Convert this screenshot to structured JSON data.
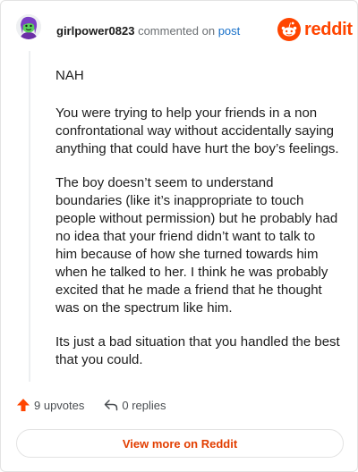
{
  "comment": {
    "author": "girlpower0823",
    "commented_on_text": "commented on",
    "post_link_label": "post",
    "paragraphs": [
      "NAH",
      "You were trying to help your friends in a non confrontational way without accidentally saying anything that could have hurt the boy’s feelings.",
      "The boy doesn’t seem to understand boundaries (like it’s inappropriate to touch people without permission) but he probably had no idea that your friend didn’t want to talk to him because of how she turned towards him when he talked to her. I think he was probably excited that he made a friend that he thought was on the spectrum like him.",
      "Its just a bad situation that you handled the best that you could."
    ]
  },
  "brand": {
    "logo_text": "reddit",
    "color": "#ff4500"
  },
  "actions": {
    "upvotes": "9 upvotes",
    "replies": "0 replies"
  },
  "footer": {
    "view_more_label": "View more on Reddit"
  }
}
